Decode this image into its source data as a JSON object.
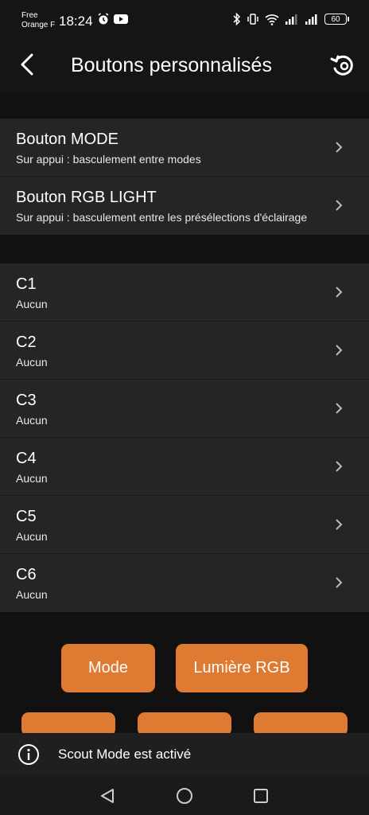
{
  "status": {
    "carrier_line1": "Free",
    "carrier_line2": "Orange F",
    "time": "18:24",
    "battery": "60"
  },
  "header": {
    "title": "Boutons personnalisés"
  },
  "system_buttons": [
    {
      "name": "Bouton MODE",
      "sub": "Sur appui : basculement entre modes"
    },
    {
      "name": "Bouton RGB LIGHT",
      "sub": "Sur appui : basculement entre les présélections d'éclairage"
    }
  ],
  "custom_buttons": [
    {
      "name": "C1",
      "sub": "Aucun"
    },
    {
      "name": "C2",
      "sub": "Aucun"
    },
    {
      "name": "C3",
      "sub": "Aucun"
    },
    {
      "name": "C4",
      "sub": "Aucun"
    },
    {
      "name": "C5",
      "sub": "Aucun"
    },
    {
      "name": "C6",
      "sub": "Aucun"
    }
  ],
  "controller_buttons": {
    "mode": "Mode",
    "rgb": "Lumière RGB"
  },
  "toast": {
    "text": "Scout Mode est activé"
  },
  "colors": {
    "accent": "#de7a32",
    "row_bg": "#252525",
    "page_bg": "#111111"
  }
}
